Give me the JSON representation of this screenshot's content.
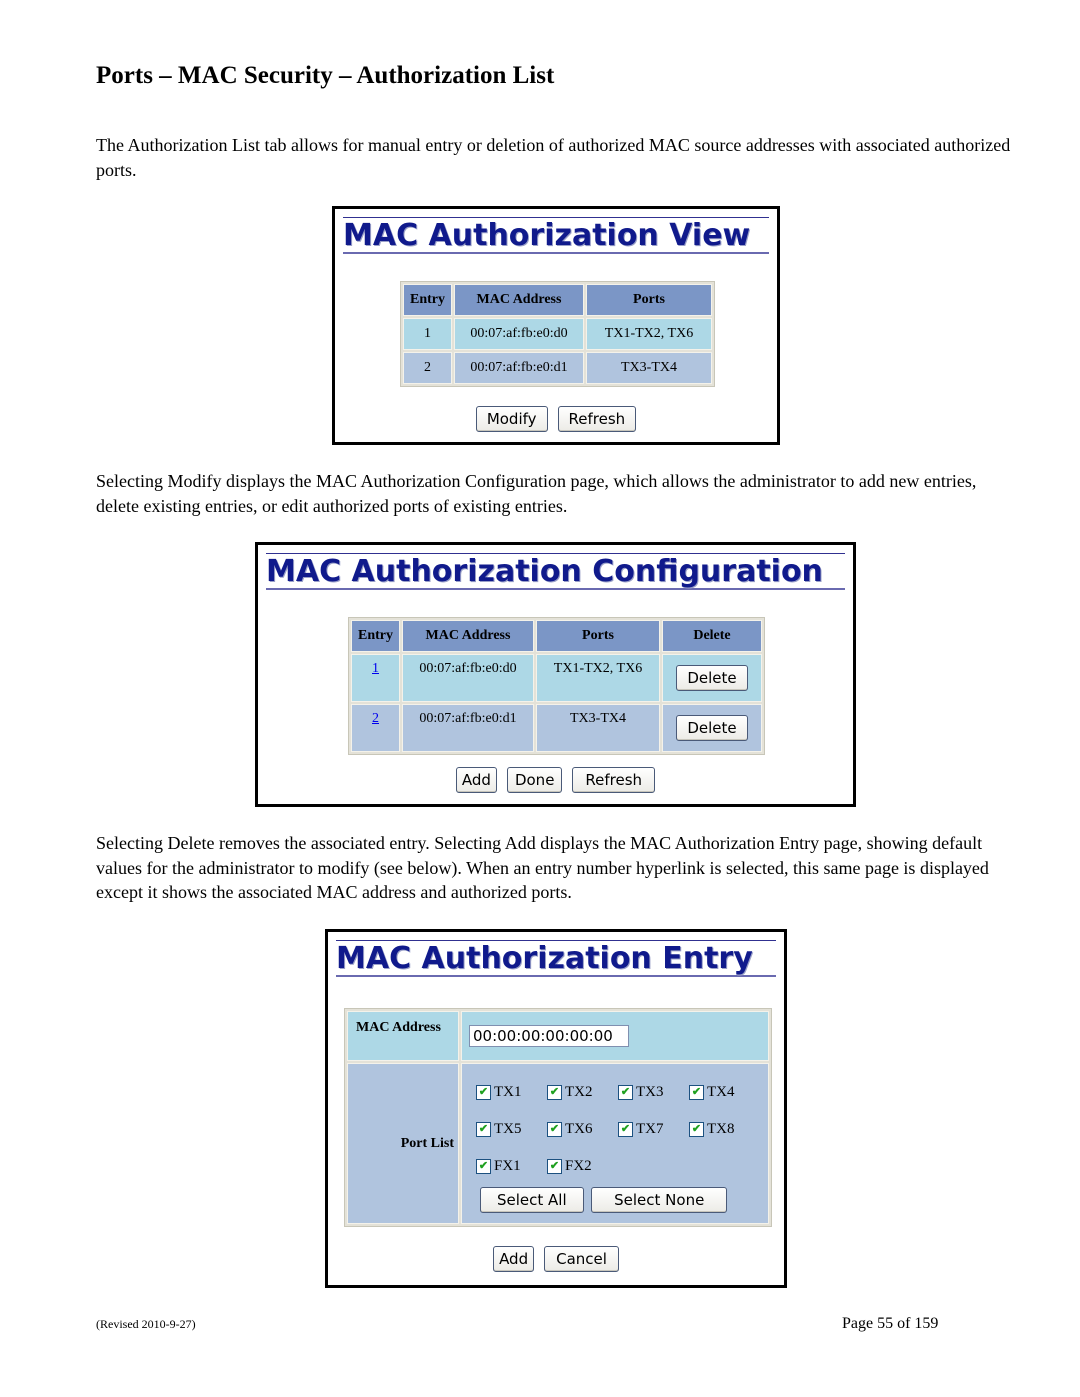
{
  "heading": "Ports – MAC Security – Authorization List",
  "paragraphs": {
    "intro": "The Authorization List tab allows for manual entry or deletion of authorized MAC source addresses with associated authorized ports.",
    "modify": "Selecting Modify displays the MAC Authorization Configuration page, which allows the administrator to add new entries, delete existing entries, or edit authorized ports of existing entries.",
    "delete": "Selecting Delete removes the associated entry.  Selecting Add displays the MAC Authorization Entry page, showing default values for the administrator to modify (see below).  When an entry number hyperlink is selected, this same page is displayed except it shows the associated MAC address and authorized ports."
  },
  "colors": {
    "title": "#101a8c",
    "header_cell": "#7b96c6",
    "row_odd": "#add8e6",
    "row_even": "#b0c4de",
    "link": "#0000ee",
    "check": "#20a020"
  },
  "view": {
    "title": "MAC Authorization View",
    "columns": [
      "Entry",
      "MAC Address",
      "Ports"
    ],
    "rows": [
      {
        "entry": "1",
        "mac": "00:07:af:fb:e0:d0",
        "ports": "TX1-TX2, TX6"
      },
      {
        "entry": "2",
        "mac": "00:07:af:fb:e0:d1",
        "ports": "TX3-TX4"
      }
    ],
    "buttons": {
      "modify": "Modify",
      "refresh": "Refresh"
    }
  },
  "config": {
    "title": "MAC Authorization Configuration",
    "columns": [
      "Entry",
      "MAC Address",
      "Ports",
      "Delete"
    ],
    "rows": [
      {
        "entry": "1",
        "mac": "00:07:af:fb:e0:d0",
        "ports": "TX1-TX2, TX6",
        "delete": "Delete"
      },
      {
        "entry": "2",
        "mac": "00:07:af:fb:e0:d1",
        "ports": "TX3-TX4",
        "delete": "Delete"
      }
    ],
    "buttons": {
      "add": "Add",
      "done": "Done",
      "refresh": "Refresh"
    }
  },
  "entry": {
    "title": "MAC Authorization Entry",
    "mac_label": "MAC Address",
    "mac_value": "00:00:00:00:00:00",
    "port_list_label": "Port List",
    "ports": [
      {
        "name": "TX1",
        "checked": true
      },
      {
        "name": "TX2",
        "checked": true
      },
      {
        "name": "TX3",
        "checked": true
      },
      {
        "name": "TX4",
        "checked": true
      },
      {
        "name": "TX5",
        "checked": true
      },
      {
        "name": "TX6",
        "checked": true
      },
      {
        "name": "TX7",
        "checked": true
      },
      {
        "name": "TX8",
        "checked": true
      },
      {
        "name": "FX1",
        "checked": true
      },
      {
        "name": "FX2",
        "checked": true
      }
    ],
    "check_glyph": "✔",
    "buttons": {
      "select_all": "Select All",
      "select_none": "Select None",
      "add": "Add",
      "cancel": "Cancel"
    }
  },
  "footer": {
    "revised": "(Revised 2010-9-27)",
    "page": "Page 55 of 159"
  }
}
